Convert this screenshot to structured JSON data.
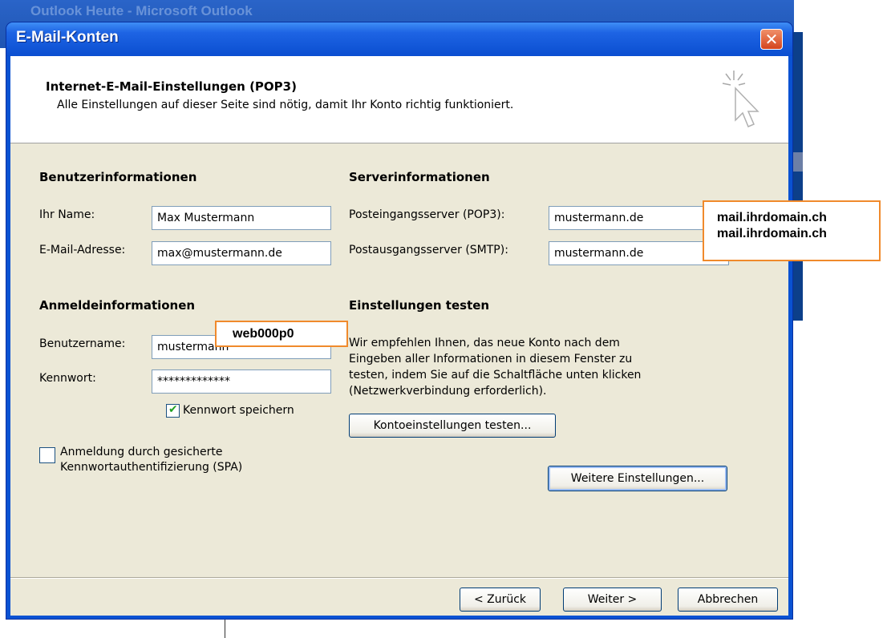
{
  "background": {
    "window_title": "Outlook Heute - Microsoft Outlook"
  },
  "dialog": {
    "title": "E-Mail-Konten",
    "close_symbol": "✕",
    "header": {
      "title": "Internet-E-Mail-Einstellungen (POP3)",
      "subtitle": "Alle Einstellungen auf dieser Seite sind nötig, damit Ihr Konto richtig funktioniert.",
      "icon": "cursor-sparkle-icon"
    },
    "user_info": {
      "section": "Benutzerinformationen",
      "name_label": "Ihr Name:",
      "name_value": "Max Mustermann",
      "email_label": "E-Mail-Adresse:",
      "email_value": "max@mustermann.de"
    },
    "server_info": {
      "section": "Serverinformationen",
      "incoming_label": "Posteingangsserver (POP3):",
      "incoming_value": "mustermann.de",
      "outgoing_label": "Postausgangsserver (SMTP):",
      "outgoing_value": "mustermann.de"
    },
    "login_info": {
      "section": "Anmeldeinformationen",
      "username_label": "Benutzername:",
      "username_value": "mustermann",
      "password_label": "Kennwort:",
      "password_value": "*************",
      "save_password_label": "Kennwort speichern",
      "save_password_checked": true,
      "spa_label_line1": "Anmeldung durch gesicherte",
      "spa_label_line2": "Kennwortauthentifizierung (SPA)",
      "spa_checked": false
    },
    "test_settings": {
      "section": "Einstellungen testen",
      "text": [
        "Wir empfehlen Ihnen, das neue Konto nach dem",
        "Eingeben aller Informationen in diesem Fenster zu",
        "testen, indem Sie auf die Schaltfläche unten klicken",
        "(Netzwerkverbindung erforderlich)."
      ],
      "test_button": "Kontoeinstellungen testen...",
      "more_settings_button": "Weitere Einstellungen..."
    },
    "footer": {
      "back_button": "< Zurück",
      "next_button": "Weiter >",
      "cancel_button": "Abbrechen"
    }
  },
  "annotations": {
    "username_overlay": "web000p0",
    "server_overlay_line1": "mail.ihrdomain.ch",
    "server_overlay_line2": "mail.ihrdomain.ch",
    "border_color": "#f08a2c"
  }
}
